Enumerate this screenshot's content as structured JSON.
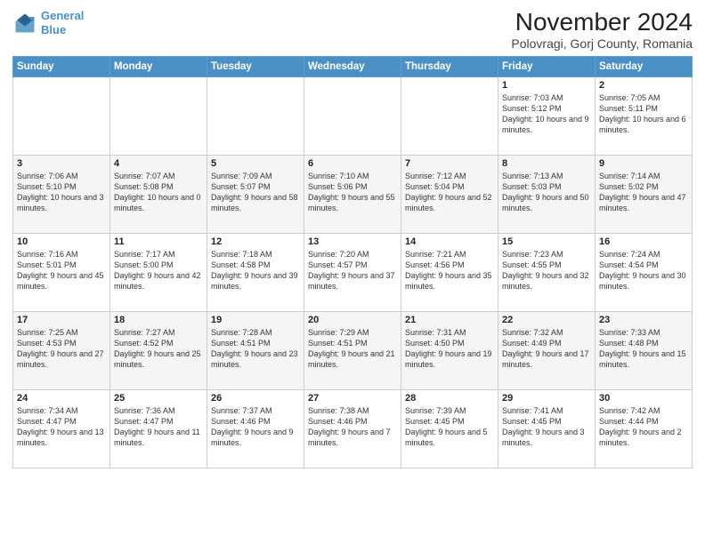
{
  "logo": {
    "line1": "General",
    "line2": "Blue"
  },
  "title": "November 2024",
  "location": "Polovragi, Gorj County, Romania",
  "days_of_week": [
    "Sunday",
    "Monday",
    "Tuesday",
    "Wednesday",
    "Thursday",
    "Friday",
    "Saturday"
  ],
  "weeks": [
    [
      {
        "day": "",
        "info": ""
      },
      {
        "day": "",
        "info": ""
      },
      {
        "day": "",
        "info": ""
      },
      {
        "day": "",
        "info": ""
      },
      {
        "day": "",
        "info": ""
      },
      {
        "day": "1",
        "info": "Sunrise: 7:03 AM\nSunset: 5:12 PM\nDaylight: 10 hours and 9 minutes."
      },
      {
        "day": "2",
        "info": "Sunrise: 7:05 AM\nSunset: 5:11 PM\nDaylight: 10 hours and 6 minutes."
      }
    ],
    [
      {
        "day": "3",
        "info": "Sunrise: 7:06 AM\nSunset: 5:10 PM\nDaylight: 10 hours and 3 minutes."
      },
      {
        "day": "4",
        "info": "Sunrise: 7:07 AM\nSunset: 5:08 PM\nDaylight: 10 hours and 0 minutes."
      },
      {
        "day": "5",
        "info": "Sunrise: 7:09 AM\nSunset: 5:07 PM\nDaylight: 9 hours and 58 minutes."
      },
      {
        "day": "6",
        "info": "Sunrise: 7:10 AM\nSunset: 5:06 PM\nDaylight: 9 hours and 55 minutes."
      },
      {
        "day": "7",
        "info": "Sunrise: 7:12 AM\nSunset: 5:04 PM\nDaylight: 9 hours and 52 minutes."
      },
      {
        "day": "8",
        "info": "Sunrise: 7:13 AM\nSunset: 5:03 PM\nDaylight: 9 hours and 50 minutes."
      },
      {
        "day": "9",
        "info": "Sunrise: 7:14 AM\nSunset: 5:02 PM\nDaylight: 9 hours and 47 minutes."
      }
    ],
    [
      {
        "day": "10",
        "info": "Sunrise: 7:16 AM\nSunset: 5:01 PM\nDaylight: 9 hours and 45 minutes."
      },
      {
        "day": "11",
        "info": "Sunrise: 7:17 AM\nSunset: 5:00 PM\nDaylight: 9 hours and 42 minutes."
      },
      {
        "day": "12",
        "info": "Sunrise: 7:18 AM\nSunset: 4:58 PM\nDaylight: 9 hours and 39 minutes."
      },
      {
        "day": "13",
        "info": "Sunrise: 7:20 AM\nSunset: 4:57 PM\nDaylight: 9 hours and 37 minutes."
      },
      {
        "day": "14",
        "info": "Sunrise: 7:21 AM\nSunset: 4:56 PM\nDaylight: 9 hours and 35 minutes."
      },
      {
        "day": "15",
        "info": "Sunrise: 7:23 AM\nSunset: 4:55 PM\nDaylight: 9 hours and 32 minutes."
      },
      {
        "day": "16",
        "info": "Sunrise: 7:24 AM\nSunset: 4:54 PM\nDaylight: 9 hours and 30 minutes."
      }
    ],
    [
      {
        "day": "17",
        "info": "Sunrise: 7:25 AM\nSunset: 4:53 PM\nDaylight: 9 hours and 27 minutes."
      },
      {
        "day": "18",
        "info": "Sunrise: 7:27 AM\nSunset: 4:52 PM\nDaylight: 9 hours and 25 minutes."
      },
      {
        "day": "19",
        "info": "Sunrise: 7:28 AM\nSunset: 4:51 PM\nDaylight: 9 hours and 23 minutes."
      },
      {
        "day": "20",
        "info": "Sunrise: 7:29 AM\nSunset: 4:51 PM\nDaylight: 9 hours and 21 minutes."
      },
      {
        "day": "21",
        "info": "Sunrise: 7:31 AM\nSunset: 4:50 PM\nDaylight: 9 hours and 19 minutes."
      },
      {
        "day": "22",
        "info": "Sunrise: 7:32 AM\nSunset: 4:49 PM\nDaylight: 9 hours and 17 minutes."
      },
      {
        "day": "23",
        "info": "Sunrise: 7:33 AM\nSunset: 4:48 PM\nDaylight: 9 hours and 15 minutes."
      }
    ],
    [
      {
        "day": "24",
        "info": "Sunrise: 7:34 AM\nSunset: 4:47 PM\nDaylight: 9 hours and 13 minutes."
      },
      {
        "day": "25",
        "info": "Sunrise: 7:36 AM\nSunset: 4:47 PM\nDaylight: 9 hours and 11 minutes."
      },
      {
        "day": "26",
        "info": "Sunrise: 7:37 AM\nSunset: 4:46 PM\nDaylight: 9 hours and 9 minutes."
      },
      {
        "day": "27",
        "info": "Sunrise: 7:38 AM\nSunset: 4:46 PM\nDaylight: 9 hours and 7 minutes."
      },
      {
        "day": "28",
        "info": "Sunrise: 7:39 AM\nSunset: 4:45 PM\nDaylight: 9 hours and 5 minutes."
      },
      {
        "day": "29",
        "info": "Sunrise: 7:41 AM\nSunset: 4:45 PM\nDaylight: 9 hours and 3 minutes."
      },
      {
        "day": "30",
        "info": "Sunrise: 7:42 AM\nSunset: 4:44 PM\nDaylight: 9 hours and 2 minutes."
      }
    ]
  ]
}
